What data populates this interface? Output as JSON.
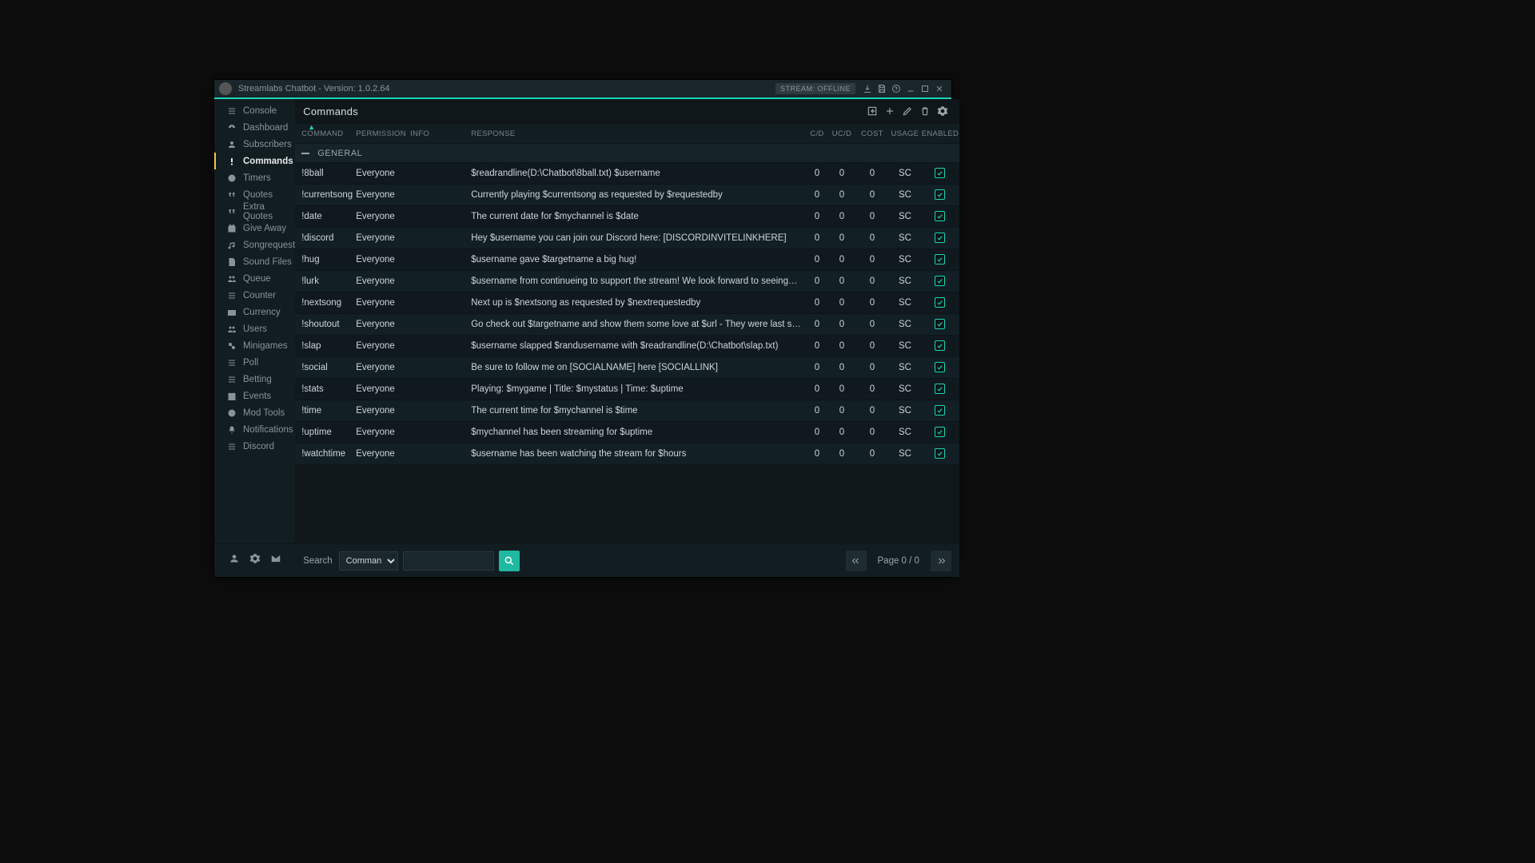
{
  "titlebar": {
    "title": "Streamlabs Chatbot - Version: 1.0.2.64",
    "stream_status": "STREAM: OFFLINE"
  },
  "sidebar": {
    "items": [
      {
        "label": "Console",
        "icon": "menu"
      },
      {
        "label": "Dashboard",
        "icon": "gauge"
      },
      {
        "label": "Subscribers",
        "icon": "person"
      },
      {
        "label": "Commands",
        "icon": "exclaim",
        "active": true
      },
      {
        "label": "Timers",
        "icon": "clock"
      },
      {
        "label": "Quotes",
        "icon": "quote"
      },
      {
        "label": "Extra Quotes",
        "icon": "quote"
      },
      {
        "label": "Give Away",
        "icon": "gift"
      },
      {
        "label": "Songrequest",
        "icon": "music"
      },
      {
        "label": "Sound Files",
        "icon": "file"
      },
      {
        "label": "Queue",
        "icon": "users"
      },
      {
        "label": "Counter",
        "icon": "menu"
      },
      {
        "label": "Currency",
        "icon": "camera"
      },
      {
        "label": "Users",
        "icon": "users"
      },
      {
        "label": "Minigames",
        "icon": "link"
      },
      {
        "label": "Poll",
        "icon": "menu"
      },
      {
        "label": "Betting",
        "icon": "menu"
      },
      {
        "label": "Events",
        "icon": "calendar"
      },
      {
        "label": "Mod Tools",
        "icon": "ban"
      },
      {
        "label": "Notifications",
        "icon": "bell"
      },
      {
        "label": "Discord",
        "icon": "menu"
      }
    ]
  },
  "main": {
    "title": "Commands",
    "columns": {
      "cmd": "COMMAND",
      "perm": "PERMISSION",
      "info": "INFO",
      "resp": "RESPONSE",
      "cd": "C/D",
      "ucd": "UC/D",
      "cost": "COST",
      "usage": "USAGE",
      "en": "ENABLED"
    },
    "group": "GENERAL",
    "rows": [
      {
        "cmd": "!8ball",
        "perm": "Everyone",
        "resp": "$readrandline(D:\\Chatbot\\8ball.txt) $username",
        "cd": "0",
        "ucd": "0",
        "cost": "0",
        "usage": "SC",
        "enabled": true
      },
      {
        "cmd": "!currentsong",
        "perm": "Everyone",
        "resp": "Currently playing $currentsong as requested by $requestedby",
        "cd": "0",
        "ucd": "0",
        "cost": "0",
        "usage": "SC",
        "enabled": true
      },
      {
        "cmd": "!date",
        "perm": "Everyone",
        "resp": "The current date for $mychannel is $date",
        "cd": "0",
        "ucd": "0",
        "cost": "0",
        "usage": "SC",
        "enabled": true
      },
      {
        "cmd": "!discord",
        "perm": "Everyone",
        "resp": "Hey $username you can join our Discord here: [DISCORDINVITELINKHERE]",
        "cd": "0",
        "ucd": "0",
        "cost": "0",
        "usage": "SC",
        "enabled": true
      },
      {
        "cmd": "!hug",
        "perm": "Everyone",
        "resp": "$username gave $targetname a big hug!",
        "cd": "0",
        "ucd": "0",
        "cost": "0",
        "usage": "SC",
        "enabled": true
      },
      {
        "cmd": "!lurk",
        "perm": "Everyone",
        "resp": "$username from continueing to support the stream! We look forward to seeing…",
        "cd": "0",
        "ucd": "0",
        "cost": "0",
        "usage": "SC",
        "enabled": true
      },
      {
        "cmd": "!nextsong",
        "perm": "Everyone",
        "resp": "Next up is $nextsong as requested by $nextrequestedby",
        "cd": "0",
        "ucd": "0",
        "cost": "0",
        "usage": "SC",
        "enabled": true
      },
      {
        "cmd": "!shoutout",
        "perm": "Everyone",
        "resp": "Go check out $targetname and show them some love at $url - They were last s…",
        "cd": "0",
        "ucd": "0",
        "cost": "0",
        "usage": "SC",
        "enabled": true
      },
      {
        "cmd": "!slap",
        "perm": "Everyone",
        "resp": "$username slapped $randusername with $readrandline(D:\\Chatbot\\slap.txt)",
        "cd": "0",
        "ucd": "0",
        "cost": "0",
        "usage": "SC",
        "enabled": true
      },
      {
        "cmd": "!social",
        "perm": "Everyone",
        "resp": "Be sure to follow me on [SOCIALNAME] here [SOCIALLINK]",
        "cd": "0",
        "ucd": "0",
        "cost": "0",
        "usage": "SC",
        "enabled": true
      },
      {
        "cmd": "!stats",
        "perm": "Everyone",
        "resp": "Playing: $mygame | Title: $mystatus | Time: $uptime",
        "cd": "0",
        "ucd": "0",
        "cost": "0",
        "usage": "SC",
        "enabled": true
      },
      {
        "cmd": "!time",
        "perm": "Everyone",
        "resp": "The current time for $mychannel is $time",
        "cd": "0",
        "ucd": "0",
        "cost": "0",
        "usage": "SC",
        "enabled": true
      },
      {
        "cmd": "!uptime",
        "perm": "Everyone",
        "resp": "$mychannel has been streaming for $uptime",
        "cd": "0",
        "ucd": "0",
        "cost": "0",
        "usage": "SC",
        "enabled": true
      },
      {
        "cmd": "!watchtime",
        "perm": "Everyone",
        "resp": "$username has been watching the stream for $hours",
        "cd": "0",
        "ucd": "0",
        "cost": "0",
        "usage": "SC",
        "enabled": true
      }
    ]
  },
  "footer": {
    "search_label": "Search",
    "search_type": "Command",
    "search_options": [
      "Command"
    ],
    "search_value": "",
    "page_text": "Page 0 / 0"
  }
}
